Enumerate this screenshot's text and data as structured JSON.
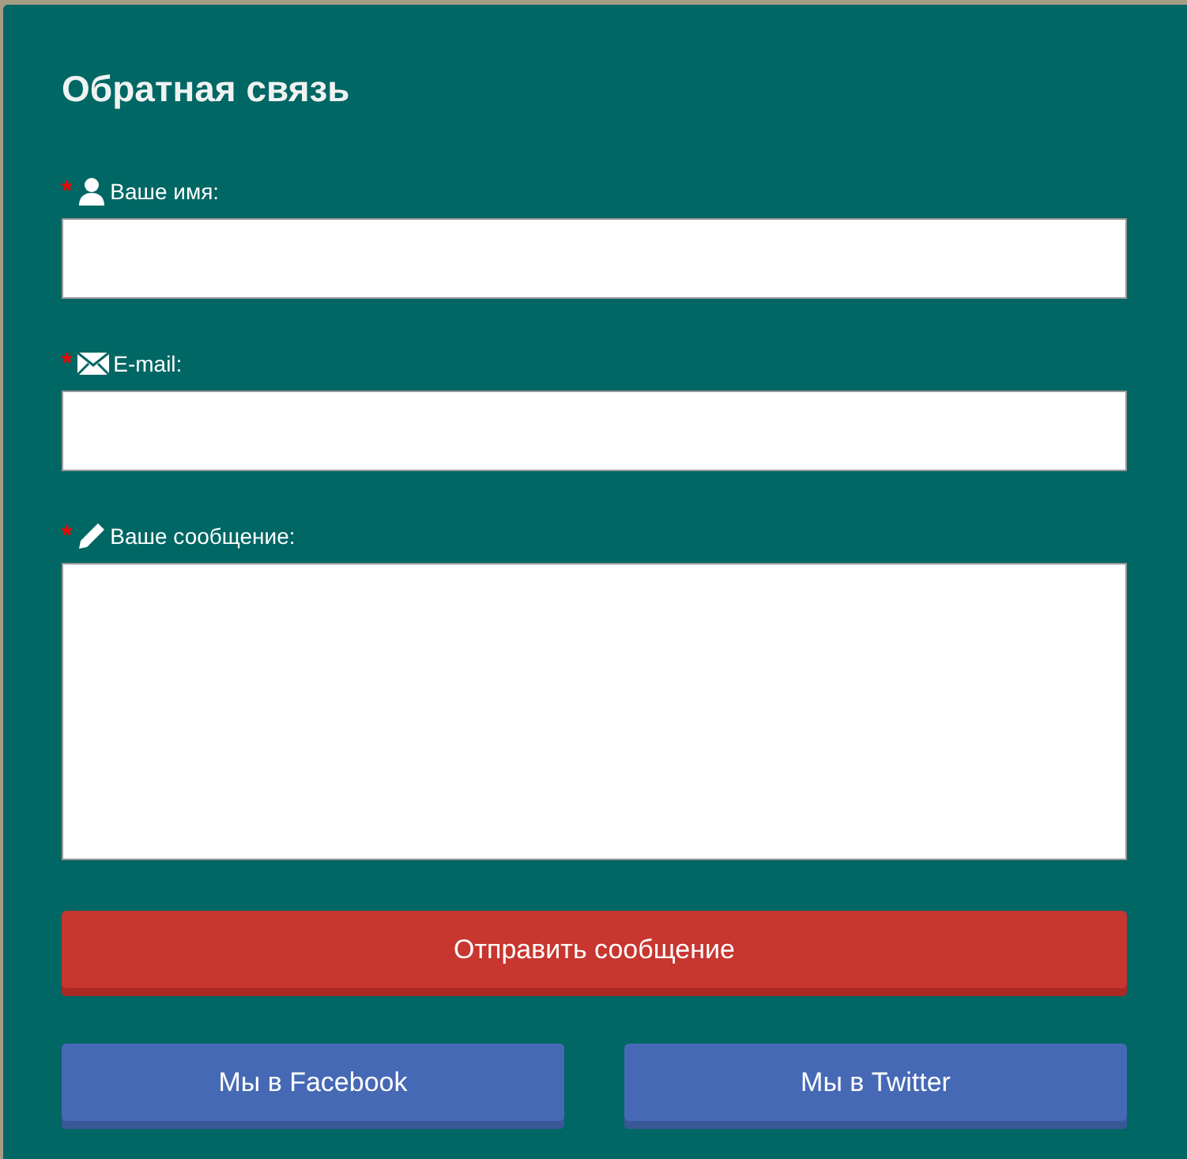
{
  "title": "Обратная связь",
  "fields": [
    {
      "kind": "person",
      "required_mark": "*",
      "label": "Ваше имя:",
      "multiline": false
    },
    {
      "kind": "mail",
      "required_mark": "*",
      "label": "E-mail:",
      "multiline": false
    },
    {
      "kind": "pencil",
      "required_mark": "*",
      "label": "Ваше сообщение:",
      "multiline": true
    }
  ],
  "submit": "Отправить сообщение",
  "social": [
    "Мы в Facebook",
    "Мы в Twitter"
  ]
}
